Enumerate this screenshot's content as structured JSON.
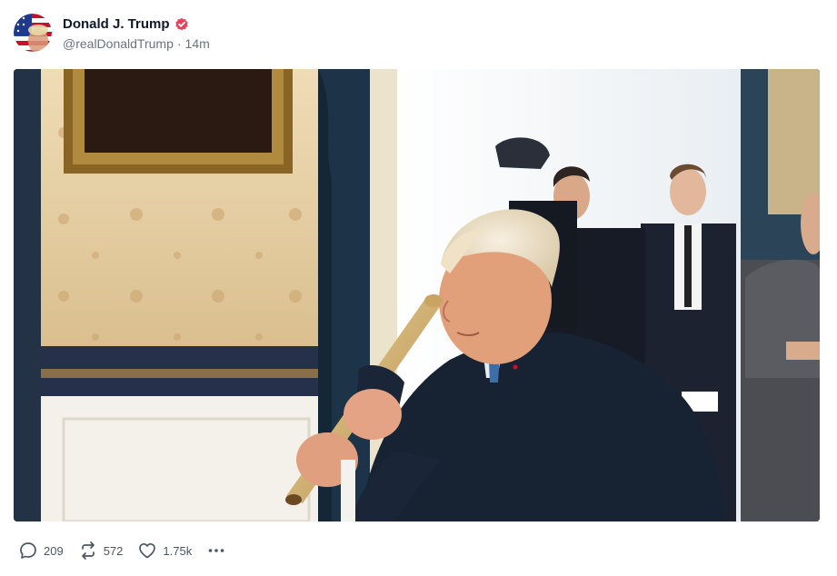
{
  "post": {
    "author": {
      "display_name": "Donald J. Trump",
      "handle": "@realDonaldTrump",
      "verified": true,
      "avatar_icon": "flag-portrait-avatar"
    },
    "time_ago": "14m",
    "separator": "·",
    "media": {
      "type": "video-still",
      "icon": "media-image"
    },
    "actions": {
      "replies": {
        "icon": "reply-icon",
        "count": "209"
      },
      "reposts": {
        "icon": "repost-icon",
        "count": "572"
      },
      "likes": {
        "icon": "heart-icon",
        "count": "1.75k"
      },
      "more": {
        "icon": "more-icon"
      }
    }
  },
  "colors": {
    "verified_badge": "#e3445c",
    "muted_text": "#6b7280",
    "icon_gray": "#4b5563"
  }
}
